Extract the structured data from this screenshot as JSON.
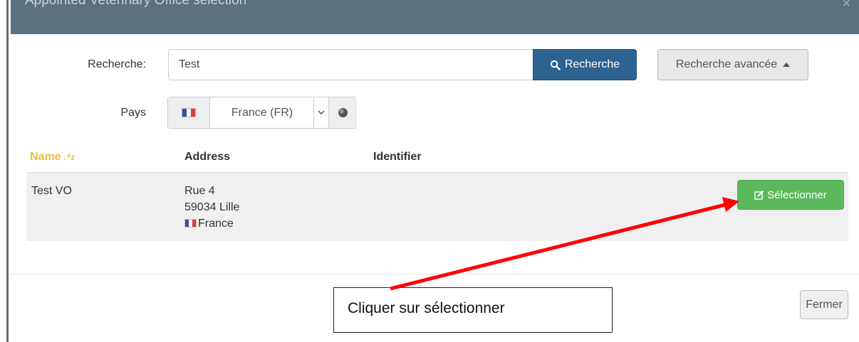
{
  "modal": {
    "title": "Appointed Veterinary Office selection",
    "close_glyph": "×"
  },
  "search": {
    "label": "Recherche:",
    "value": "Test",
    "button_label": "Recherche",
    "button_icon": "search-icon",
    "advanced_label": "Recherche avancée",
    "advanced_icon": "caret-up-icon"
  },
  "country": {
    "label": "Pays",
    "selected": "France (FR)",
    "flag_icon": "france-flag-icon",
    "globe_icon": "globe-icon"
  },
  "table": {
    "headers": [
      "Name",
      "Address",
      "Identifier"
    ],
    "rows": [
      {
        "name": "Test VO",
        "address": [
          "Rue 4",
          "59034 Lille",
          "France"
        ],
        "identifier": "",
        "action_label": "Sélectionner",
        "action_icon": "edit-icon"
      }
    ]
  },
  "footer": {
    "close_label": "Fermer"
  },
  "annotation": {
    "text": "Cliquer sur sélectionner",
    "arrow_color": "#ff0000"
  },
  "colors": {
    "header_bg": "#5a7181",
    "primary_button": "#2d6390",
    "success_button": "#5cb85c",
    "sort_highlight": "#f0c040"
  }
}
